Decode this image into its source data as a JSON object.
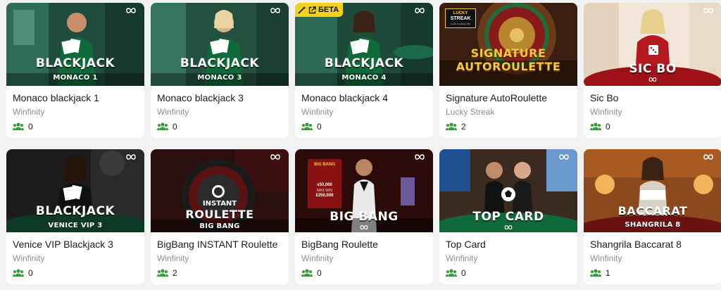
{
  "colors": {
    "background": "#f2f2f2",
    "card": "#ffffff",
    "players_icon": "#3a9a3a",
    "beta_badge": "#f3d21c"
  },
  "games": [
    {
      "name": "Monaco blackjack 1",
      "provider": "Winfinity",
      "players": "0",
      "thumb": {
        "title": "BLACKJACK",
        "subtitle": "MONACO 1",
        "scene": "bj-green"
      }
    },
    {
      "name": "Monaco blackjack 3",
      "provider": "Winfinity",
      "players": "0",
      "thumb": {
        "title": "BLACKJACK",
        "subtitle": "MONACO 3",
        "scene": "bj-green"
      }
    },
    {
      "name": "Monaco blackjack 4",
      "provider": "Winfinity",
      "players": "0",
      "thumb": {
        "title": "BLACKJACK",
        "subtitle": "MONACO 4",
        "scene": "bj-green",
        "badge": "БЕТА"
      }
    },
    {
      "name": "Signature AutoRoulette",
      "provider": "Lucky Streak",
      "players": "2",
      "thumb": {
        "title_line1": "SIGNATURE",
        "title_line2": "AUTOROULETTE",
        "brand_line1": "LUCKY",
        "brand_line2": "STREAK",
        "brand_tagline": "Luck to play fair",
        "scene": "roulette-wheel"
      }
    },
    {
      "name": "Sic Bo",
      "provider": "Winfinity",
      "players": "0",
      "thumb": {
        "title": "SIC BO",
        "scene": "red-room"
      }
    },
    {
      "name": "Venice VIP Blackjack 3",
      "provider": "Winfinity",
      "players": "0",
      "thumb": {
        "title": "BLACKJACK",
        "subtitle": "VENICE VIP 3",
        "scene": "dark-room"
      }
    },
    {
      "name": "BigBang INSTANT Roulette",
      "provider": "Winfinity",
      "players": "2",
      "thumb": {
        "title_small": "INSTANT",
        "title": "ROULETTE",
        "subtitle": "BIG BANG",
        "scene": "dark-red"
      }
    },
    {
      "name": "BigBang Roulette",
      "provider": "Winfinity",
      "players": "0",
      "thumb": {
        "title": "BIG BANG",
        "scene": "dark-red",
        "screen_title": "BIG BANG",
        "screen_values": [
          "x50,000",
          "MAX WIN",
          "€250,000"
        ]
      }
    },
    {
      "name": "Top Card",
      "provider": "Winfinity",
      "players": "0",
      "thumb": {
        "title": "TOP CARD",
        "scene": "green-table"
      }
    },
    {
      "name": "Shangrila Baccarat 8",
      "provider": "Winfinity",
      "players": "1",
      "thumb": {
        "title": "BACCARAT",
        "subtitle": "SHANGRILA 8",
        "scene": "warm-room"
      }
    }
  ]
}
